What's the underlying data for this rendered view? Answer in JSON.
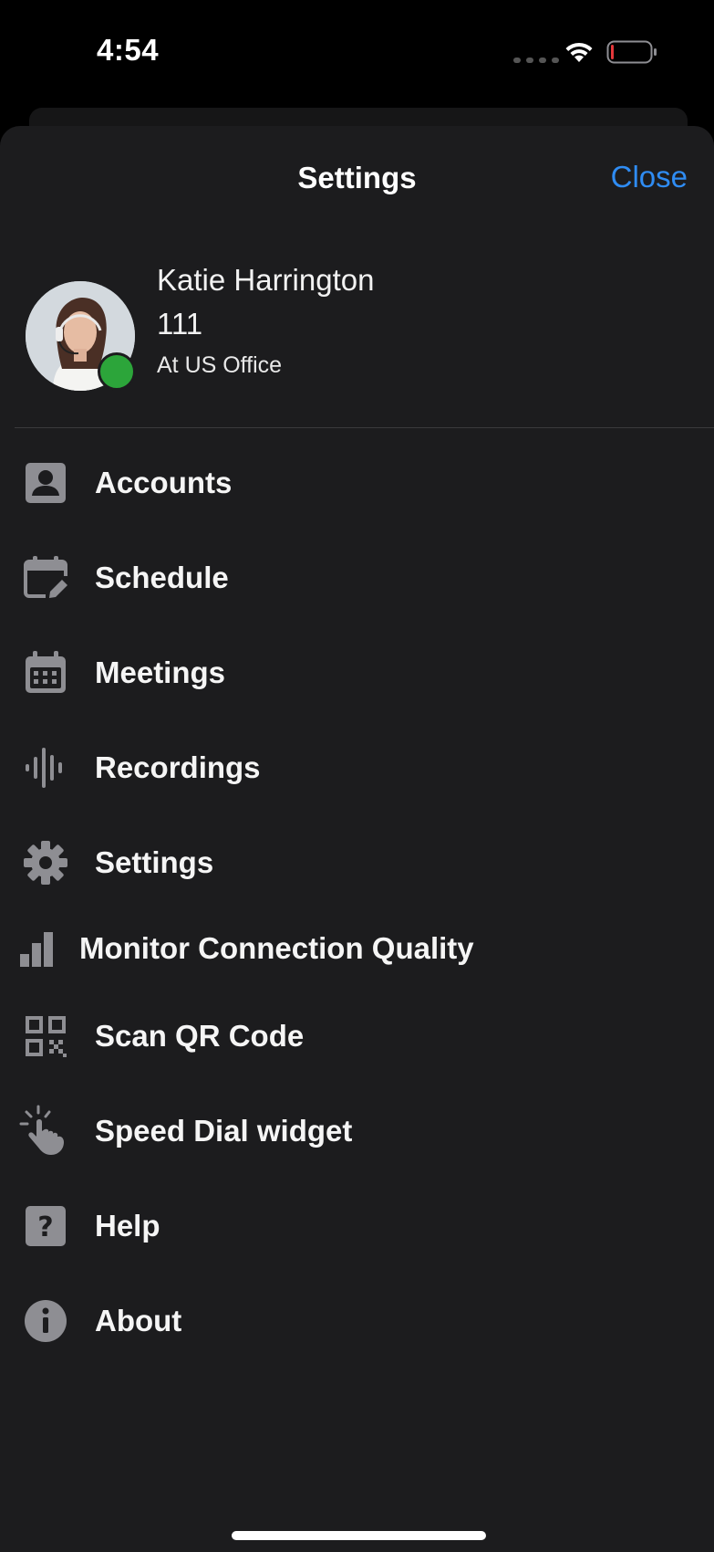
{
  "status_bar": {
    "time": "4:54",
    "icons": [
      "signal-dots-icon",
      "wifi-icon",
      "battery-low-icon"
    ]
  },
  "header": {
    "title": "Settings",
    "close_label": "Close",
    "accent_color": "#2f8cf3"
  },
  "profile": {
    "name": "Katie Harrington",
    "extension": "111",
    "status": "At US Office",
    "presence_color": "#2ca53a",
    "presence": "available"
  },
  "menu": {
    "items": [
      {
        "label": "Accounts",
        "icon": "account-icon"
      },
      {
        "label": "Schedule",
        "icon": "calendar-edit-icon"
      },
      {
        "label": "Meetings",
        "icon": "calendar-icon"
      },
      {
        "label": "Recordings",
        "icon": "waveform-icon"
      },
      {
        "label": "Settings",
        "icon": "gear-icon"
      },
      {
        "label": "Monitor Connection Quality",
        "icon": "signal-bars-icon"
      },
      {
        "label": "Scan QR Code",
        "icon": "qr-code-icon"
      },
      {
        "label": "Speed Dial widget",
        "icon": "tap-hand-icon"
      },
      {
        "label": "Help",
        "icon": "help-icon"
      },
      {
        "label": "About",
        "icon": "info-icon"
      }
    ]
  }
}
